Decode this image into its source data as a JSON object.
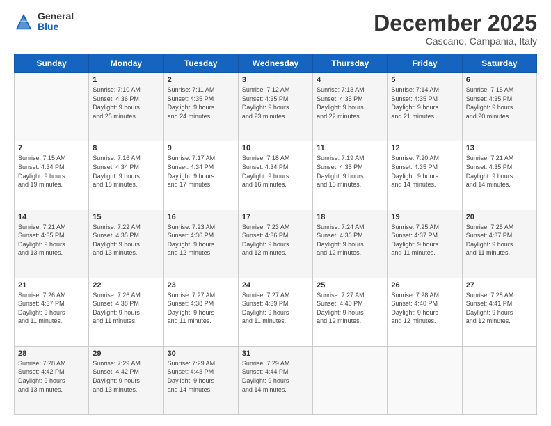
{
  "logo": {
    "general": "General",
    "blue": "Blue"
  },
  "title": "December 2025",
  "subtitle": "Cascano, Campania, Italy",
  "days_of_week": [
    "Sunday",
    "Monday",
    "Tuesday",
    "Wednesday",
    "Thursday",
    "Friday",
    "Saturday"
  ],
  "weeks": [
    [
      {
        "day": "",
        "info": ""
      },
      {
        "day": "1",
        "info": "Sunrise: 7:10 AM\nSunset: 4:36 PM\nDaylight: 9 hours\nand 25 minutes."
      },
      {
        "day": "2",
        "info": "Sunrise: 7:11 AM\nSunset: 4:35 PM\nDaylight: 9 hours\nand 24 minutes."
      },
      {
        "day": "3",
        "info": "Sunrise: 7:12 AM\nSunset: 4:35 PM\nDaylight: 9 hours\nand 23 minutes."
      },
      {
        "day": "4",
        "info": "Sunrise: 7:13 AM\nSunset: 4:35 PM\nDaylight: 9 hours\nand 22 minutes."
      },
      {
        "day": "5",
        "info": "Sunrise: 7:14 AM\nSunset: 4:35 PM\nDaylight: 9 hours\nand 21 minutes."
      },
      {
        "day": "6",
        "info": "Sunrise: 7:15 AM\nSunset: 4:35 PM\nDaylight: 9 hours\nand 20 minutes."
      }
    ],
    [
      {
        "day": "7",
        "info": "Sunrise: 7:15 AM\nSunset: 4:34 PM\nDaylight: 9 hours\nand 19 minutes."
      },
      {
        "day": "8",
        "info": "Sunrise: 7:16 AM\nSunset: 4:34 PM\nDaylight: 9 hours\nand 18 minutes."
      },
      {
        "day": "9",
        "info": "Sunrise: 7:17 AM\nSunset: 4:34 PM\nDaylight: 9 hours\nand 17 minutes."
      },
      {
        "day": "10",
        "info": "Sunrise: 7:18 AM\nSunset: 4:34 PM\nDaylight: 9 hours\nand 16 minutes."
      },
      {
        "day": "11",
        "info": "Sunrise: 7:19 AM\nSunset: 4:35 PM\nDaylight: 9 hours\nand 15 minutes."
      },
      {
        "day": "12",
        "info": "Sunrise: 7:20 AM\nSunset: 4:35 PM\nDaylight: 9 hours\nand 14 minutes."
      },
      {
        "day": "13",
        "info": "Sunrise: 7:21 AM\nSunset: 4:35 PM\nDaylight: 9 hours\nand 14 minutes."
      }
    ],
    [
      {
        "day": "14",
        "info": "Sunrise: 7:21 AM\nSunset: 4:35 PM\nDaylight: 9 hours\nand 13 minutes."
      },
      {
        "day": "15",
        "info": "Sunrise: 7:22 AM\nSunset: 4:35 PM\nDaylight: 9 hours\nand 13 minutes."
      },
      {
        "day": "16",
        "info": "Sunrise: 7:23 AM\nSunset: 4:36 PM\nDaylight: 9 hours\nand 12 minutes."
      },
      {
        "day": "17",
        "info": "Sunrise: 7:23 AM\nSunset: 4:36 PM\nDaylight: 9 hours\nand 12 minutes."
      },
      {
        "day": "18",
        "info": "Sunrise: 7:24 AM\nSunset: 4:36 PM\nDaylight: 9 hours\nand 12 minutes."
      },
      {
        "day": "19",
        "info": "Sunrise: 7:25 AM\nSunset: 4:37 PM\nDaylight: 9 hours\nand 11 minutes."
      },
      {
        "day": "20",
        "info": "Sunrise: 7:25 AM\nSunset: 4:37 PM\nDaylight: 9 hours\nand 11 minutes."
      }
    ],
    [
      {
        "day": "21",
        "info": "Sunrise: 7:26 AM\nSunset: 4:37 PM\nDaylight: 9 hours\nand 11 minutes."
      },
      {
        "day": "22",
        "info": "Sunrise: 7:26 AM\nSunset: 4:38 PM\nDaylight: 9 hours\nand 11 minutes."
      },
      {
        "day": "23",
        "info": "Sunrise: 7:27 AM\nSunset: 4:38 PM\nDaylight: 9 hours\nand 11 minutes."
      },
      {
        "day": "24",
        "info": "Sunrise: 7:27 AM\nSunset: 4:39 PM\nDaylight: 9 hours\nand 11 minutes."
      },
      {
        "day": "25",
        "info": "Sunrise: 7:27 AM\nSunset: 4:40 PM\nDaylight: 9 hours\nand 12 minutes."
      },
      {
        "day": "26",
        "info": "Sunrise: 7:28 AM\nSunset: 4:40 PM\nDaylight: 9 hours\nand 12 minutes."
      },
      {
        "day": "27",
        "info": "Sunrise: 7:28 AM\nSunset: 4:41 PM\nDaylight: 9 hours\nand 12 minutes."
      }
    ],
    [
      {
        "day": "28",
        "info": "Sunrise: 7:28 AM\nSunset: 4:42 PM\nDaylight: 9 hours\nand 13 minutes."
      },
      {
        "day": "29",
        "info": "Sunrise: 7:29 AM\nSunset: 4:42 PM\nDaylight: 9 hours\nand 13 minutes."
      },
      {
        "day": "30",
        "info": "Sunrise: 7:29 AM\nSunset: 4:43 PM\nDaylight: 9 hours\nand 14 minutes."
      },
      {
        "day": "31",
        "info": "Sunrise: 7:29 AM\nSunset: 4:44 PM\nDaylight: 9 hours\nand 14 minutes."
      },
      {
        "day": "",
        "info": ""
      },
      {
        "day": "",
        "info": ""
      },
      {
        "day": "",
        "info": ""
      }
    ]
  ]
}
